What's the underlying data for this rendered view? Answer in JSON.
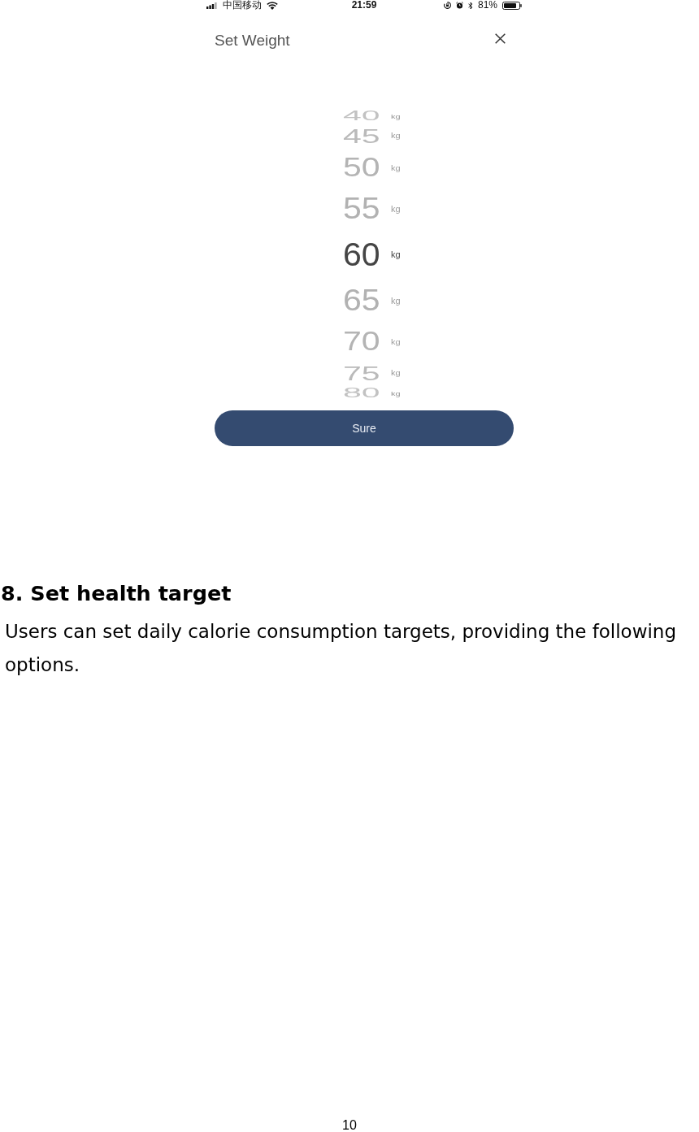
{
  "status_bar": {
    "carrier": "中国移动",
    "time": "21:59",
    "battery": "81%"
  },
  "dialog": {
    "title": "Set Weight",
    "picker": {
      "options": [
        {
          "value": "40",
          "unit": "kg",
          "selected": false
        },
        {
          "value": "45",
          "unit": "kg",
          "selected": false
        },
        {
          "value": "50",
          "unit": "kg",
          "selected": false
        },
        {
          "value": "55",
          "unit": "kg",
          "selected": false
        },
        {
          "value": "60",
          "unit": "kg",
          "selected": true
        },
        {
          "value": "65",
          "unit": "kg",
          "selected": false
        },
        {
          "value": "70",
          "unit": "kg",
          "selected": false
        },
        {
          "value": "75",
          "unit": "kg",
          "selected": false
        },
        {
          "value": "80",
          "unit": "kg",
          "selected": false
        }
      ]
    },
    "confirm_button": "Sure"
  },
  "document": {
    "heading": "8. Set health target",
    "paragraph": "Users can set daily calorie consumption targets, providing the following options.",
    "page_number": "10"
  }
}
